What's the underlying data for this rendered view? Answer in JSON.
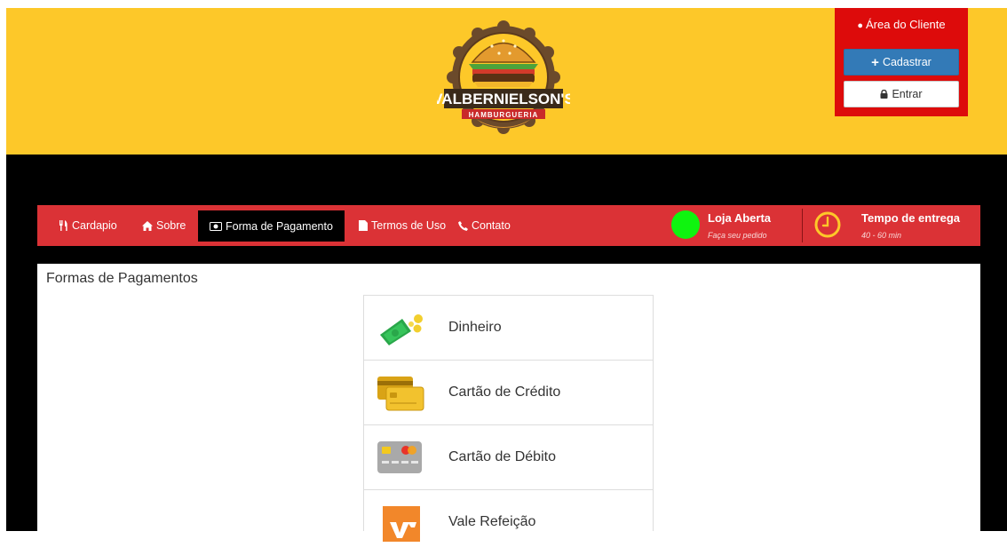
{
  "brand": {
    "name": "VALBERNIELSON'S",
    "tagline": "HAMBURGUERIA",
    "colors": {
      "header": "#fdc829",
      "nav": "#db3236",
      "client_box": "#dd0b0b"
    }
  },
  "client_area": {
    "title": "Área do Cliente",
    "register_label": "Cadastrar",
    "login_label": "Entrar",
    "user_icon": "user-icon",
    "plus_icon": "plus-icon",
    "lock_icon": "lock-icon"
  },
  "nav": {
    "items": [
      {
        "label": "Cardapio",
        "icon": "cutlery-icon"
      },
      {
        "label": "Sobre",
        "icon": "home-icon"
      },
      {
        "label": "Forma de Pagamento",
        "icon": "money-icon"
      },
      {
        "label": "Termos de Uso",
        "icon": "document-icon"
      },
      {
        "label": "Contato",
        "icon": "phone-icon"
      }
    ],
    "active_item": "Forma de Pagamento",
    "status": {
      "title": "Loja Aberta",
      "subtitle": "Faça seu pedido",
      "color": "#0ff40f"
    },
    "delivery": {
      "title": "Tempo de entrega",
      "subtitle": "40 - 60 min"
    }
  },
  "content": {
    "title": "Formas de Pagamentos",
    "payments": [
      {
        "label": "Dinheiro",
        "icon": "cash-icon"
      },
      {
        "label": "Cartão de Crédito",
        "icon": "credit-card-icon"
      },
      {
        "label": "Cartão de Débito",
        "icon": "debit-card-icon"
      },
      {
        "label": "Vale Refeição",
        "icon": "meal-voucher-icon"
      }
    ]
  }
}
